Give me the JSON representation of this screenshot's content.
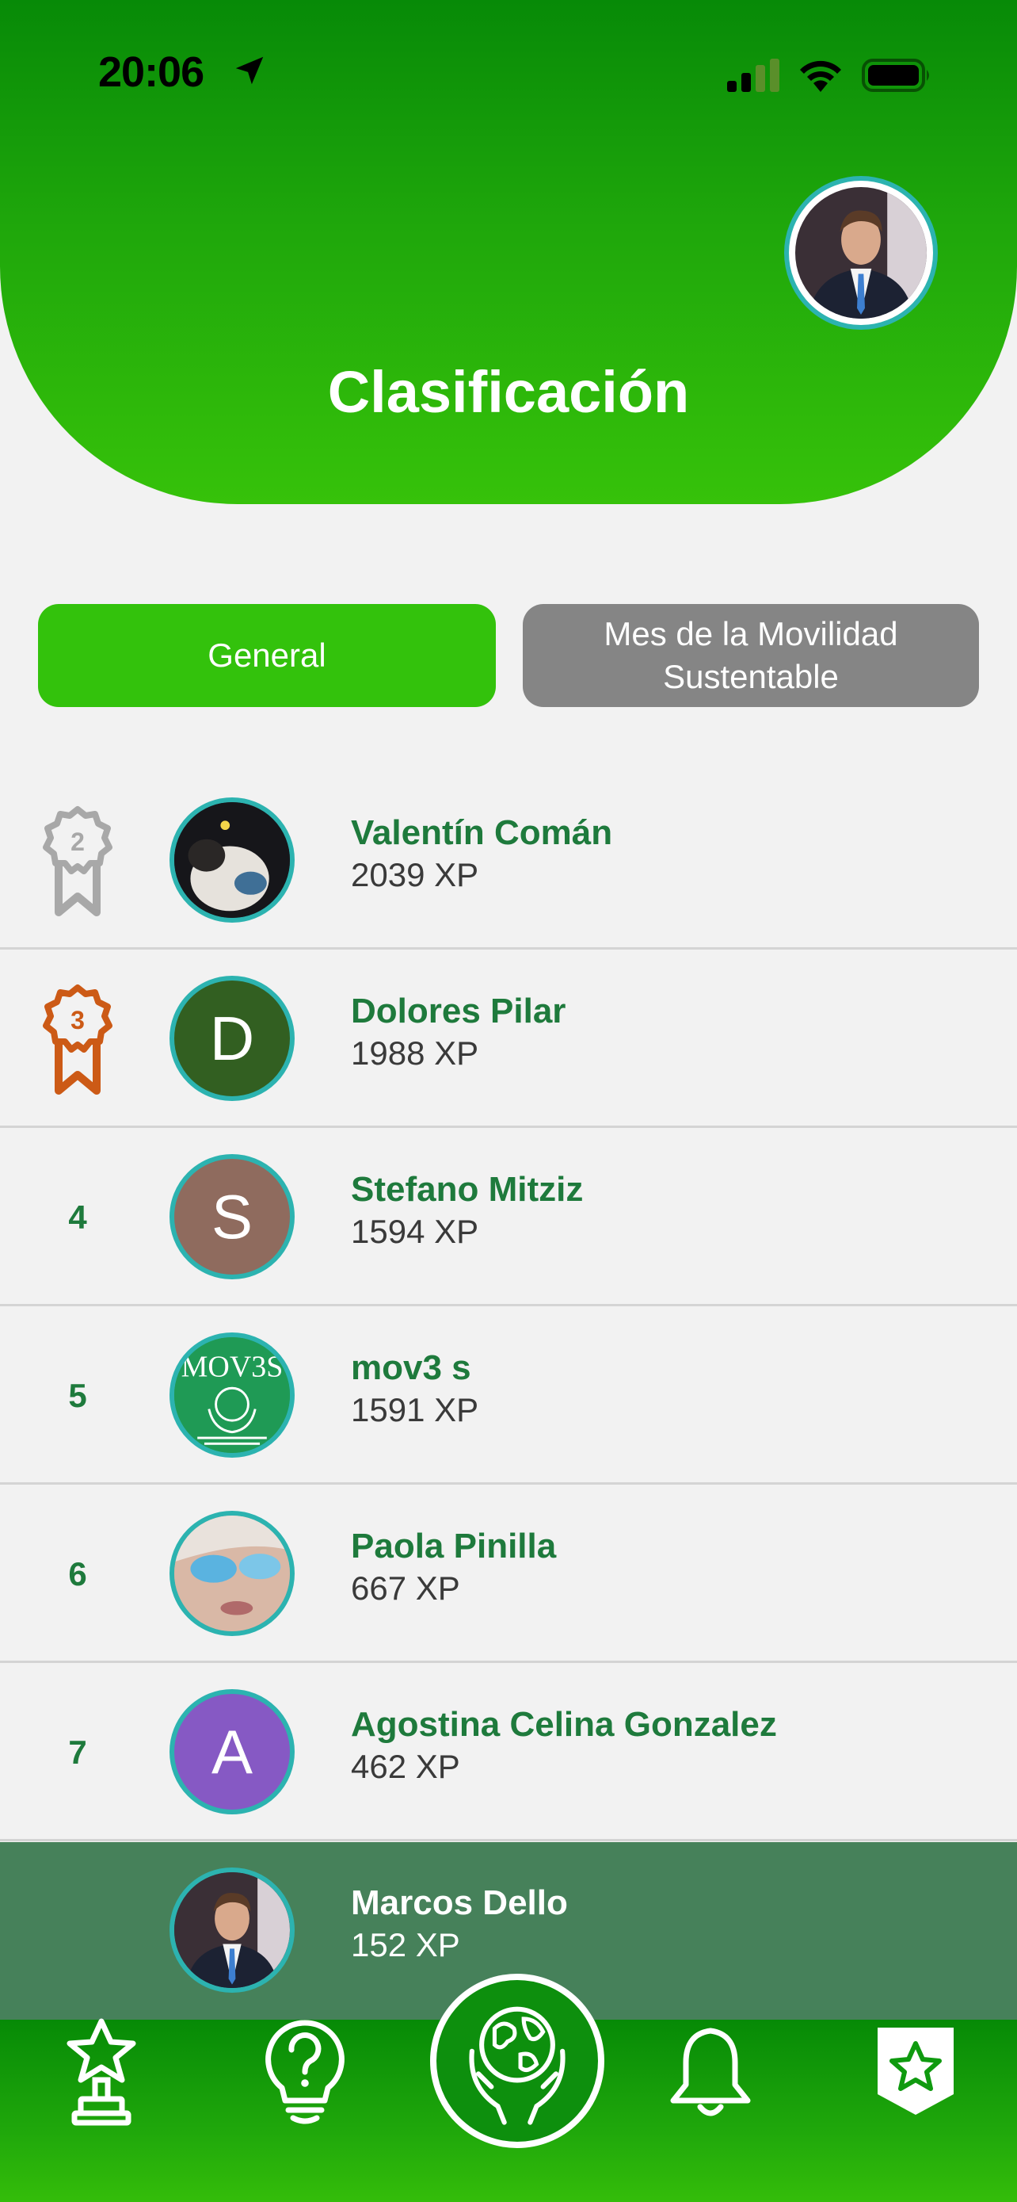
{
  "status_bar": {
    "time": "20:06"
  },
  "header": {
    "title": "Clasificación"
  },
  "tabs": [
    {
      "label": "General",
      "active": true
    },
    {
      "label": "Mes de la Movilidad Sustentable",
      "active": false
    }
  ],
  "leaderboard": [
    {
      "rank": "2",
      "name": "Valentín Comán",
      "xp": "2039 XP",
      "badge": "silver-medal-icon"
    },
    {
      "rank": "3",
      "name": "Dolores Pilar",
      "xp": "1988 XP",
      "badge": "bronze-medal-icon",
      "initial": "D"
    },
    {
      "rank": "4",
      "name": "Stefano Mitziz",
      "xp": "1594 XP",
      "initial": "S"
    },
    {
      "rank": "5",
      "name": "mov3 s",
      "xp": "1591 XP"
    },
    {
      "rank": "6",
      "name": "Paola Pinilla",
      "xp": "667 XP"
    },
    {
      "rank": "7",
      "name": "Agostina Celina Gonzalez",
      "xp": "462 XP",
      "initial": "A"
    }
  ],
  "current_user": {
    "name": "Marcos Dello",
    "xp": "152 XP"
  },
  "colors": {
    "header_green": "#1fa70b",
    "active_tab": "#33c20c",
    "inactive_tab": "#858585",
    "name_green": "#1e7a3c",
    "current_user_row": "#46815a",
    "avatar_ring": "#2cb3b0"
  },
  "nav": [
    "trophy-icon",
    "help-bulb-icon",
    "earth-hands-icon",
    "bell-icon",
    "star-shield-icon"
  ]
}
